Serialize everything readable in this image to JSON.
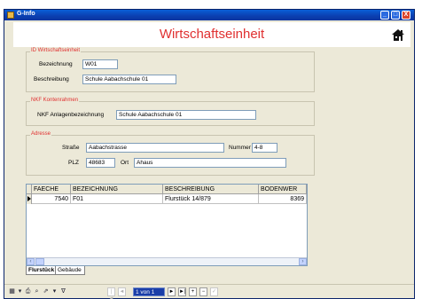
{
  "window": {
    "title": "G-Info",
    "controls": {
      "minimize": "_",
      "maximize": "□",
      "close": "X"
    }
  },
  "page": {
    "title": "Wirtschaftseinheit",
    "home_icon": "house-icon"
  },
  "groups": {
    "id": {
      "legend": "ID Wirtschaftseinheit",
      "bezeichnung_label": "Bezeichnung",
      "bezeichnung_value": "W01",
      "beschreibung_label": "Beschreibung",
      "beschreibung_value": "Schule Aabachschule 01"
    },
    "nkf": {
      "legend": "NKF Kontenrahmen",
      "anlagen_label": "NKF Anlagenbezeichnung",
      "anlagen_value": "Schule Aabachschule 01"
    },
    "adresse": {
      "legend": "Adresse",
      "strasse_label": "Straße",
      "strasse_value": "Aabachstrasse",
      "nummer_label": "Nummer",
      "nummer_value": "4-8",
      "plz_label": "PLZ",
      "plz_value": "48683",
      "ort_label": "Ort",
      "ort_value": "Ahaus"
    }
  },
  "grid": {
    "columns": [
      "FAECHE",
      "BEZEICHNUNG",
      "BESCHREIBUNG",
      "BODENWER"
    ],
    "rows": [
      [
        "7540",
        "F01",
        "Flurstück 14/879",
        "8369"
      ]
    ]
  },
  "tabs": [
    {
      "label": "Flurstück"
    },
    {
      "label": "Gebäude"
    }
  ],
  "navigator": {
    "record": "1 von 1",
    "first": "|◄",
    "prev": "◄",
    "next": "►",
    "last": "►|",
    "add": "+",
    "delete": "−",
    "save": "✓"
  },
  "colors": {
    "accent_red": "#e03030",
    "titlebar_blue": "#0a5fd8",
    "face": "#ece9d8"
  }
}
